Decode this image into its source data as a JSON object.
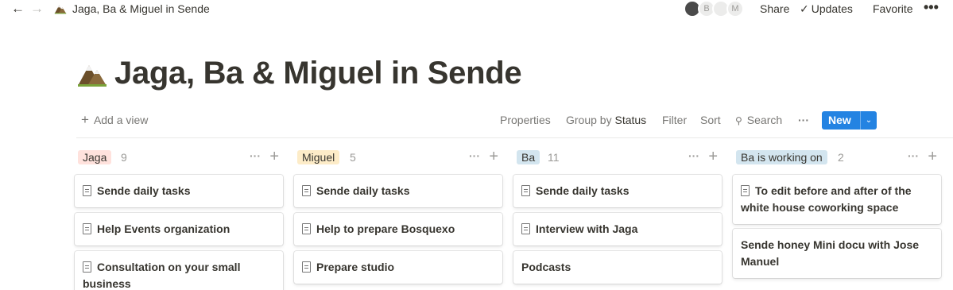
{
  "topbar": {
    "back_icon": "arrow-left-icon",
    "forward_icon": "arrow-right-icon",
    "breadcrumb_title": "Jaga, Ba & Miguel in Sende",
    "avatars": [
      "",
      "B",
      "",
      "M"
    ],
    "share_label": "Share",
    "updates_label": "Updates",
    "favorite_label": "Favorite",
    "more_icon": "more-horizontal-icon"
  },
  "page": {
    "title": "Jaga, Ba & Miguel in Sende",
    "icon": "mountain-icon"
  },
  "view_bar": {
    "add_view_label": "Add a view",
    "properties_label": "Properties",
    "group_by_label": "Group by",
    "group_by_value": "Status",
    "filter_label": "Filter",
    "sort_label": "Sort",
    "search_label": "Search",
    "new_label": "New",
    "accent": "#2383e2"
  },
  "board": {
    "columns": [
      {
        "tag": "Jaga",
        "count": "9",
        "tag_color": "#ffe2dd",
        "cards": [
          {
            "text": "Sende daily tasks",
            "has_icon": true
          },
          {
            "text": "Help Events organization",
            "has_icon": true
          },
          {
            "text": "Consultation on your small business",
            "has_icon": true
          }
        ]
      },
      {
        "tag": "Miguel",
        "count": "5",
        "tag_color": "#fdecc8",
        "cards": [
          {
            "text": "Sende daily tasks",
            "has_icon": true
          },
          {
            "text": "Help to prepare Bosquexo",
            "has_icon": true
          },
          {
            "text": "Prepare studio",
            "has_icon": true
          }
        ]
      },
      {
        "tag": "Ba",
        "count": "11",
        "tag_color": "#d3e5ef",
        "cards": [
          {
            "text": "Sende daily tasks",
            "has_icon": true
          },
          {
            "text": "Interview with Jaga",
            "has_icon": true
          },
          {
            "text": "Podcasts",
            "has_icon": false
          }
        ]
      },
      {
        "tag": "Ba is working on",
        "count": "2",
        "tag_color": "#d3e5ef",
        "cards": [
          {
            "text": "To edit before and after of the white house coworking space",
            "has_icon": true
          },
          {
            "text": "Sende honey Mini docu with Jose Manuel",
            "has_icon": false
          }
        ]
      }
    ]
  }
}
